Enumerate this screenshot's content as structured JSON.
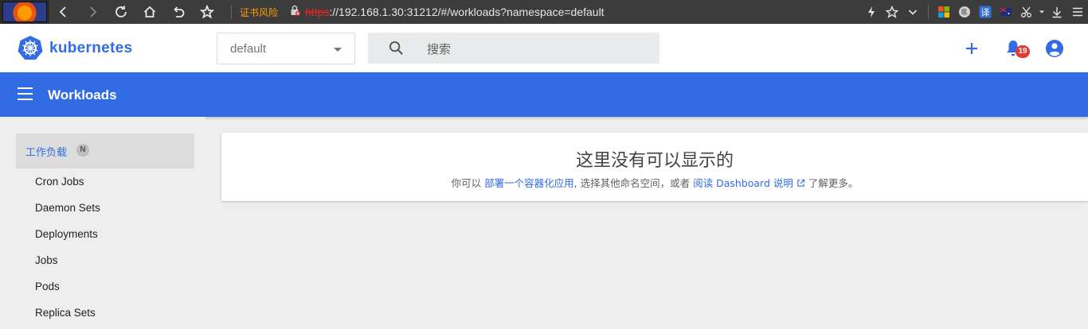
{
  "browser": {
    "risk_label": "证书风险",
    "url_scheme": "https",
    "url_rest": "://192.168.1.30:31212/#/workloads?namespace=default",
    "translate_label": "译"
  },
  "header": {
    "brand": "kubernetes",
    "namespace": "default",
    "search_placeholder": "搜索",
    "notification_count": "19",
    "accent_color": "#326ce5"
  },
  "toolbar": {
    "title": "Workloads"
  },
  "sidebar": {
    "section_label": "工作负载",
    "section_badge": "N",
    "items": [
      {
        "label": "Cron Jobs"
      },
      {
        "label": "Daemon Sets"
      },
      {
        "label": "Deployments"
      },
      {
        "label": "Jobs"
      },
      {
        "label": "Pods"
      },
      {
        "label": "Replica Sets"
      }
    ]
  },
  "empty_state": {
    "title": "这里没有可以显示的",
    "desc_prefix": "你可以",
    "deploy_link": "部署一个容器化应用",
    "desc_middle": ", 选择其他命名空间，或者",
    "docs_link": "阅读 Dashboard 说明",
    "desc_suffix": "了解更多。"
  }
}
